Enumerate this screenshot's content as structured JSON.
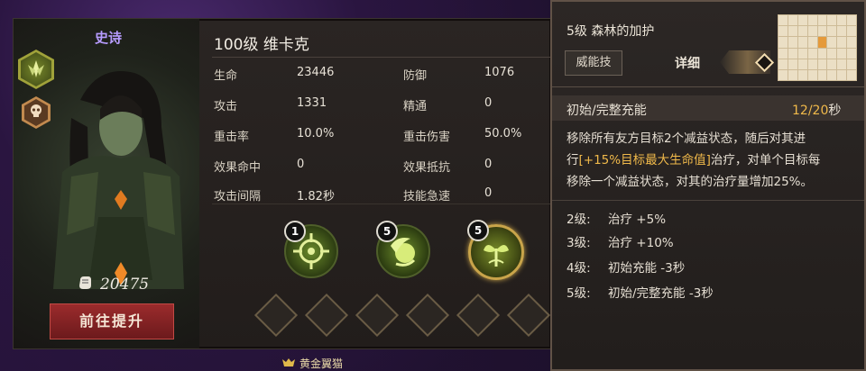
{
  "hero": {
    "rarity": "史诗",
    "name": "100级  维卡克",
    "power": "20475",
    "upgrade_label": "前往提升"
  },
  "stats": [
    {
      "label": "生命",
      "value": "23446"
    },
    {
      "label": "防御",
      "value": "1076"
    },
    {
      "label": "攻击",
      "value": "1331"
    },
    {
      "label": "精通",
      "value": "0"
    },
    {
      "label": "重击率",
      "value": "10.0%"
    },
    {
      "label": "重击伤害",
      "value": "50.0%"
    },
    {
      "label": "效果命中",
      "value": "0"
    },
    {
      "label": "效果抵抗",
      "value": "0"
    },
    {
      "label": "攻击间隔",
      "value": "1.82秒"
    },
    {
      "label": "技能急速",
      "value": "0"
    }
  ],
  "skills": [
    {
      "level": "1"
    },
    {
      "level": "5"
    },
    {
      "level": "5"
    }
  ],
  "bottom_tag": "黄金翼猫",
  "skill_detail": {
    "title": "5级  森林的加护",
    "tag": "威能技",
    "detail_label": "详细",
    "charge_label": "初始/完整充能",
    "charge_current": "12",
    "charge_sep": "/",
    "charge_full": "20",
    "charge_unit": "秒",
    "desc_1": "移除所有友方目标2个减益状态，随后对其进",
    "desc_2a": "行",
    "desc_2b": "[+15%目标最大生命值]",
    "desc_2c": "治疗，对单个目标每",
    "desc_3": "移除一个减益状态，对其的治疗量增加25%。",
    "levels": [
      {
        "lvl": "2级:",
        "text": "治疗 +5%"
      },
      {
        "lvl": "3级:",
        "text": "治疗 +10%"
      },
      {
        "lvl": "4级:",
        "text": "初始充能 -3秒"
      },
      {
        "lvl": "5级:",
        "text": "初始/完整充能 -3秒"
      }
    ]
  },
  "colors": {
    "rarity": "#b79cff",
    "accent_gold": "#f0b94a",
    "button_red": "#8a2224"
  },
  "icons": [
    "nature-class-icon",
    "skull-icon",
    "power-fist-icon",
    "crosshair-skill-icon",
    "leaf-orb-skill-icon",
    "sprout-skill-icon",
    "cat-wing-icon"
  ]
}
